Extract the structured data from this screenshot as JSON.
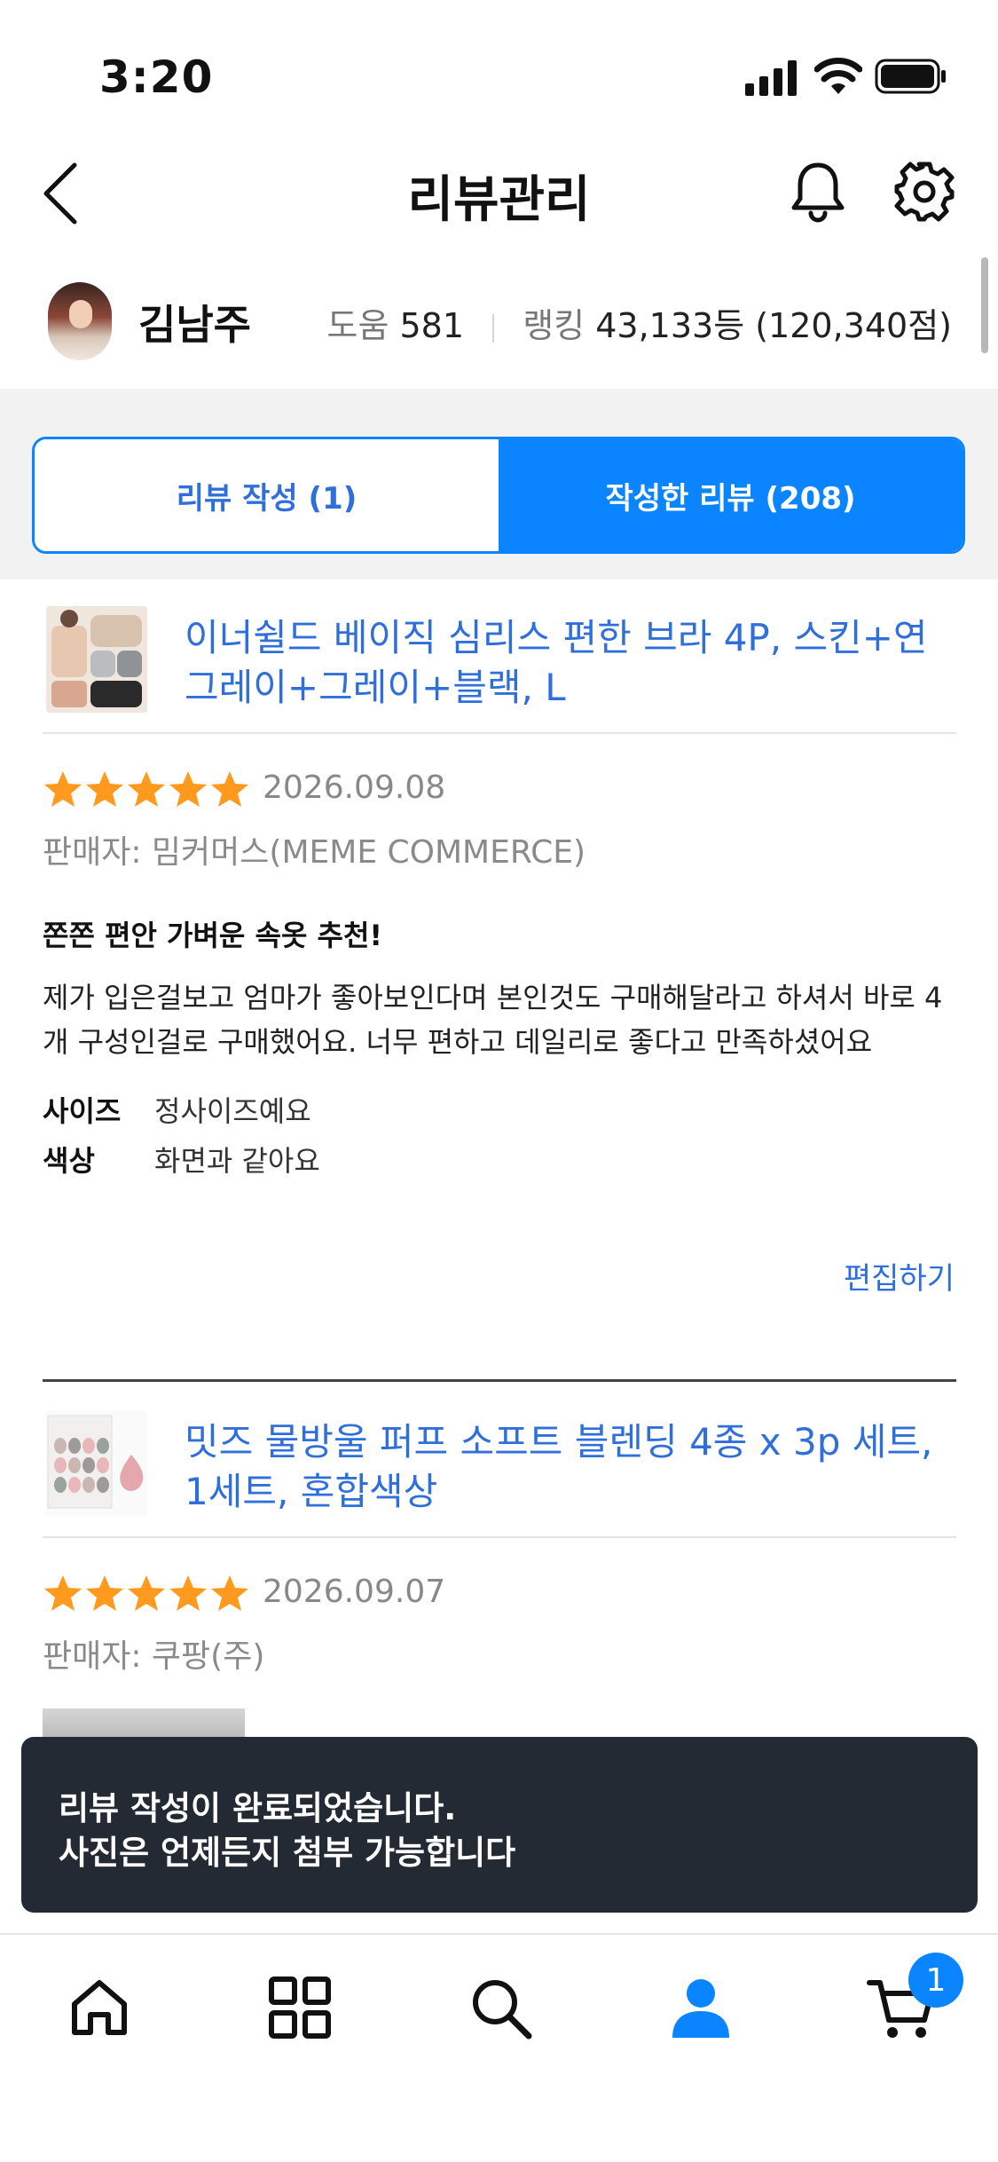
{
  "status_bar": {
    "time": "3:20"
  },
  "header": {
    "title": "리뷰관리"
  },
  "profile": {
    "name": "김남주",
    "help_label": "도움",
    "help_count": "581",
    "ranking_label": "랭킹",
    "ranking_value": "43,133등 (120,340점)"
  },
  "tabs": [
    {
      "label": "리뷰 작성 (1)"
    },
    {
      "label": "작성한 리뷰 (208)"
    }
  ],
  "reviews": [
    {
      "product_title": "이너쉴드 베이직 심리스 편한 브라 4P, 스킨+연그레이+그레이+블랙, L",
      "rating": 5,
      "date": "2026.09.08",
      "seller": "판매자: 밈커머스(MEME COMMERCE)",
      "headline": "쫀쫀 편안 가벼운 속옷 추천!",
      "body": "제가 입은걸보고 엄마가 좋아보인다며 본인것도 구매해달라고 하셔서 바로 4개 구성인걸로 구매했어요. 너무 편하고 데일리로 좋다고 만족하셨어요",
      "attributes": [
        {
          "key": "사이즈",
          "value": "정사이즈예요"
        },
        {
          "key": "색상",
          "value": "화면과 같아요"
        }
      ],
      "edit_label": "편집하기"
    },
    {
      "product_title": "밋즈 물방울 퍼프 소프트 블렌딩 4종 x 3p 세트, 1세트, 혼합색상",
      "rating": 5,
      "date": "2026.09.07",
      "seller": "판매자: 쿠팡(주)"
    }
  ],
  "toast": {
    "line1": "리뷰 작성이 완료되었습니다.",
    "line2": "사진은 언제든지 첨부 가능합니다"
  },
  "bottom_nav": {
    "items": [
      "home-icon",
      "categories-icon",
      "search-icon",
      "profile-icon",
      "cart-icon"
    ],
    "active": "profile-icon",
    "cart_count": "1"
  },
  "colors": {
    "accent": "#0a84ff",
    "link": "#2f6fdc",
    "star": "#ff9a1f",
    "toast_bg": "#232a33"
  }
}
